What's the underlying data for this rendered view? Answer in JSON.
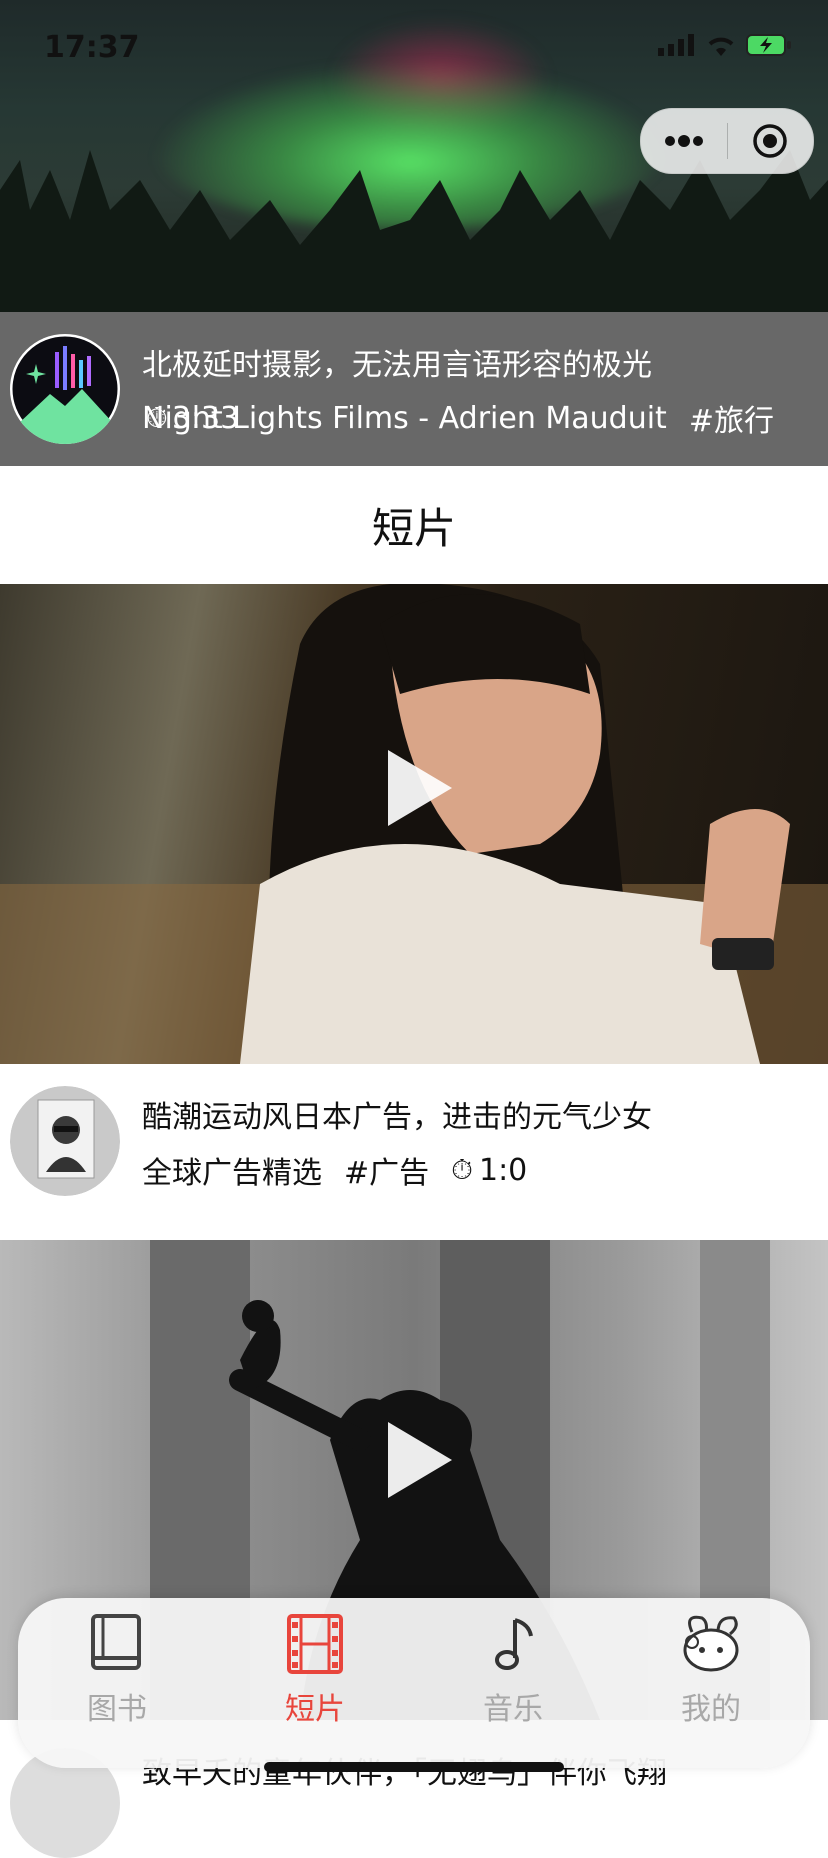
{
  "status": {
    "time": "17:37"
  },
  "hero": {
    "title": "北极延时摄影，无法用言语形容的极光",
    "author": "Night Lights Films - Adrien Mauduit",
    "duration": "3:33",
    "tag": "#旅行"
  },
  "section": {
    "title": "短片"
  },
  "videos": [
    {
      "title": "酷潮运动风日本广告，进击的元气少女",
      "author": "全球广告精选",
      "tag": "#广告",
      "duration": "1:0"
    },
    {
      "title": "致早夭的童年伙伴，「无翅鸟」伴你飞翔"
    }
  ],
  "tabs": [
    {
      "label": "图书",
      "icon": "book-icon",
      "active": false
    },
    {
      "label": "短片",
      "icon": "film-icon",
      "active": true
    },
    {
      "label": "音乐",
      "icon": "music-note-icon",
      "active": false
    },
    {
      "label": "我的",
      "icon": "bunny-avatar-icon",
      "active": false
    }
  ],
  "colors": {
    "accent": "#e8453c",
    "inactive": "#a8a8a8",
    "hero_bar": "#686868"
  }
}
